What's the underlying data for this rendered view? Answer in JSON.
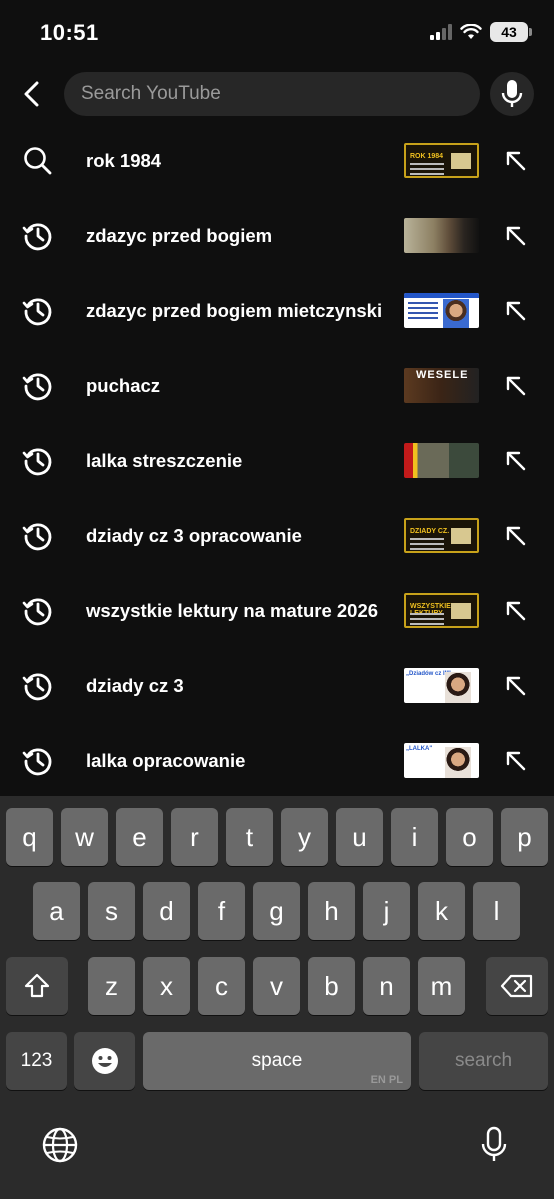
{
  "status_bar": {
    "time": "10:51",
    "battery": "43"
  },
  "search": {
    "placeholder": "Search YouTube"
  },
  "suggestions": [
    {
      "text": "rok 1984",
      "icon": "search-icon",
      "thumb": "yellow",
      "thumb_title": "ROK 1984"
    },
    {
      "text": "zdazyc przed bogiem",
      "icon": "history-icon",
      "thumb": "paint"
    },
    {
      "text": "zdazyc przed bogiem mietczynski",
      "icon": "history-icon",
      "thumb": "blue"
    },
    {
      "text": "puchacz",
      "icon": "history-icon",
      "thumb": "wesele",
      "thumb_title": "WESELE"
    },
    {
      "text": "lalka streszczenie",
      "icon": "history-icon",
      "thumb": "film"
    },
    {
      "text": "dziady cz 3 opracowanie",
      "icon": "history-icon",
      "thumb": "yellow",
      "thumb_title": "DZIADY CZ. III"
    },
    {
      "text": "wszystkie lektury na mature 2026",
      "icon": "history-icon",
      "thumb": "yellow",
      "thumb_title": "WSZYSTKIE LEKTURY"
    },
    {
      "text": "dziady cz 3",
      "icon": "history-icon",
      "thumb": "blue",
      "thumb_title": "„Dziadów cz III\""
    },
    {
      "text": "lalka opracowanie",
      "icon": "history-icon",
      "thumb": "white",
      "thumb_title": "„LALKA\""
    }
  ],
  "keyboard": {
    "row1": [
      "q",
      "w",
      "e",
      "r",
      "t",
      "y",
      "u",
      "i",
      "o",
      "p"
    ],
    "row2": [
      "a",
      "s",
      "d",
      "f",
      "g",
      "h",
      "j",
      "k",
      "l"
    ],
    "row3": [
      "z",
      "x",
      "c",
      "v",
      "b",
      "n",
      "m"
    ],
    "numbers_label": "123",
    "space_label": "space",
    "lang_label": "EN PL",
    "search_label": "search"
  }
}
